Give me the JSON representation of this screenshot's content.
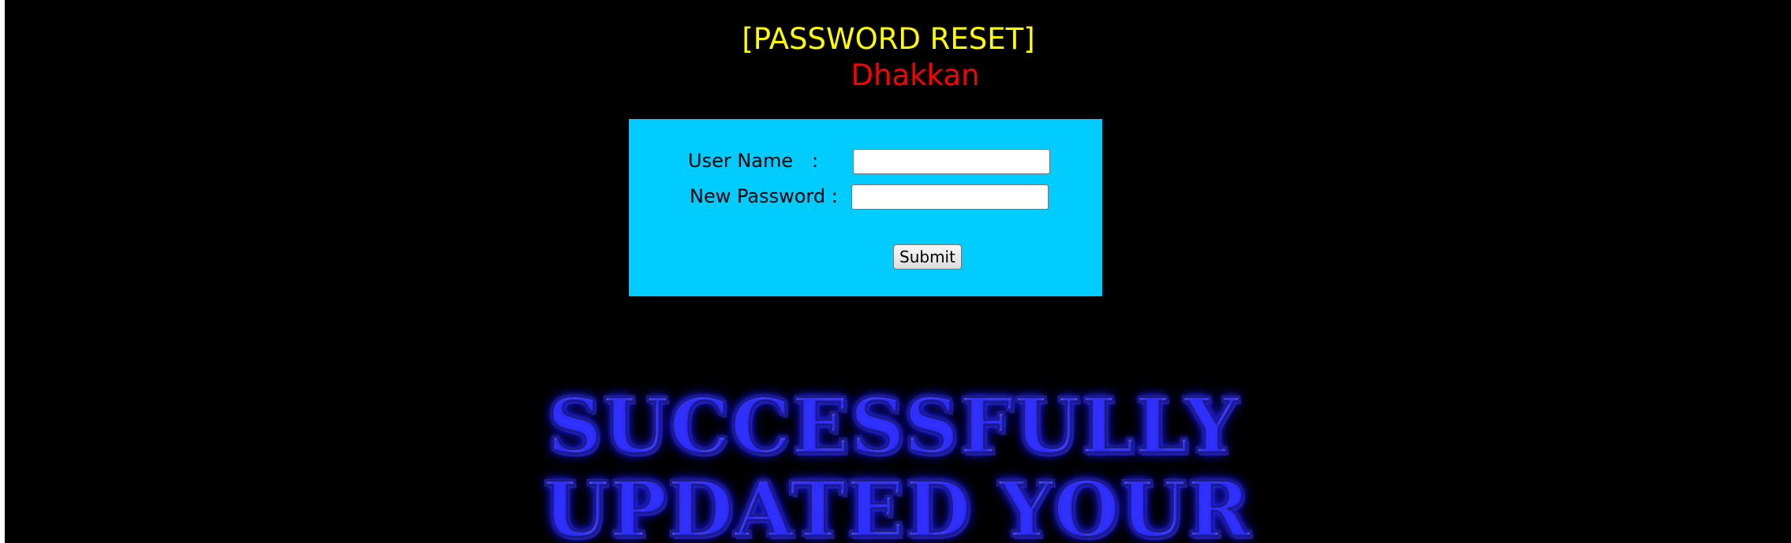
{
  "header": {
    "title": "[PASSWORD RESET]",
    "subtitle": "Dhakkan"
  },
  "form": {
    "username_label": "User Name",
    "username_colon": ":",
    "username_value": "",
    "password_label": "New Password :",
    "password_value": "",
    "submit_label": "Submit"
  },
  "banner": {
    "line1": "SUCCESSFULLY",
    "line2": "UPDATED YOUR"
  },
  "colors": {
    "page_background": "#000000",
    "title": "#ffff00",
    "subtitle": "#ff0000",
    "form_background": "#00ccff",
    "banner_glow": "#2020ff"
  }
}
